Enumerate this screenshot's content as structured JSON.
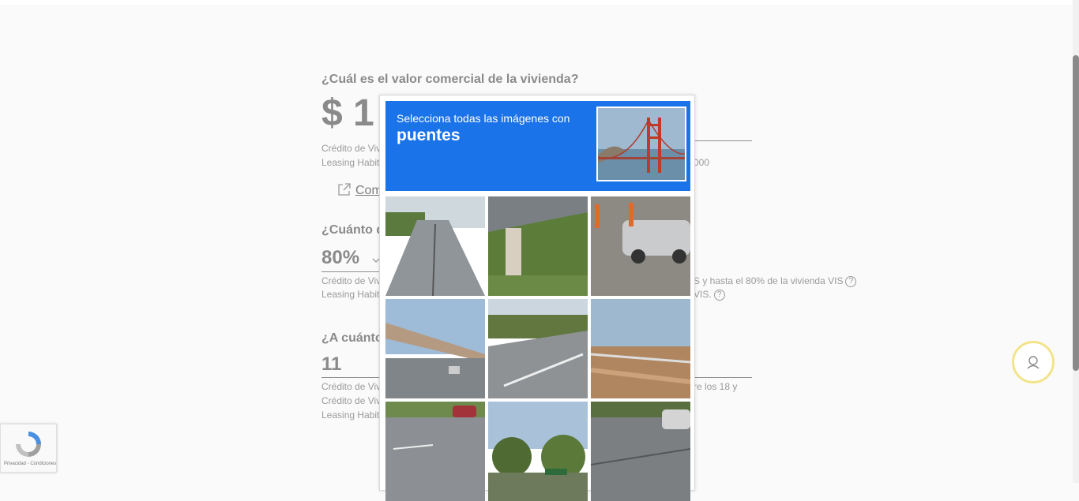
{
  "form": {
    "q1": "¿Cuál es el valor comercial de la vivienda?",
    "q1_value": "$ 1",
    "q1_note1": "Crédito de Viv",
    "q1_note2": "Leasing Habit",
    "q1_note2_tail": "000",
    "compare_link": "Com",
    "q2": "¿Cuánto d",
    "q2_value": "80%",
    "q2_note1": "Crédito de Viv",
    "q2_note1_tail": "S y hasta el 80% de la vivienda VIS",
    "q2_note2": "Leasing Habit",
    "q2_note2_tail": "VIS.",
    "q3": "¿A cuánto",
    "q3_value": "11",
    "q3_note1": "Crédito de Viv",
    "q3_note1_tail": "re los 18 y",
    "q3_note2": "Crédito de Viv",
    "q3_note3": "Leasing Habit",
    "help_glyph": "?"
  },
  "captcha": {
    "instruction": "Selecciona todas las imágenes con",
    "target": "puentes",
    "tiles": [
      "road-street-tile",
      "overpass-pillar-tile",
      "car-construction-tile",
      "elevated-highway-tile",
      "road-curve-tile",
      "bridge-railing-tile",
      "intersection-tile",
      "trees-sign-tile",
      "road-car-tile"
    ]
  },
  "recaptcha_badge": {
    "text": "Privacidad - Condiciones"
  },
  "icons": {
    "external_link": "external-link-icon",
    "chevron": "chevron-down-icon",
    "support": "support-agent-icon"
  },
  "colors": {
    "captcha_blue": "#1a73e8",
    "support_ring": "#f3e48a"
  }
}
